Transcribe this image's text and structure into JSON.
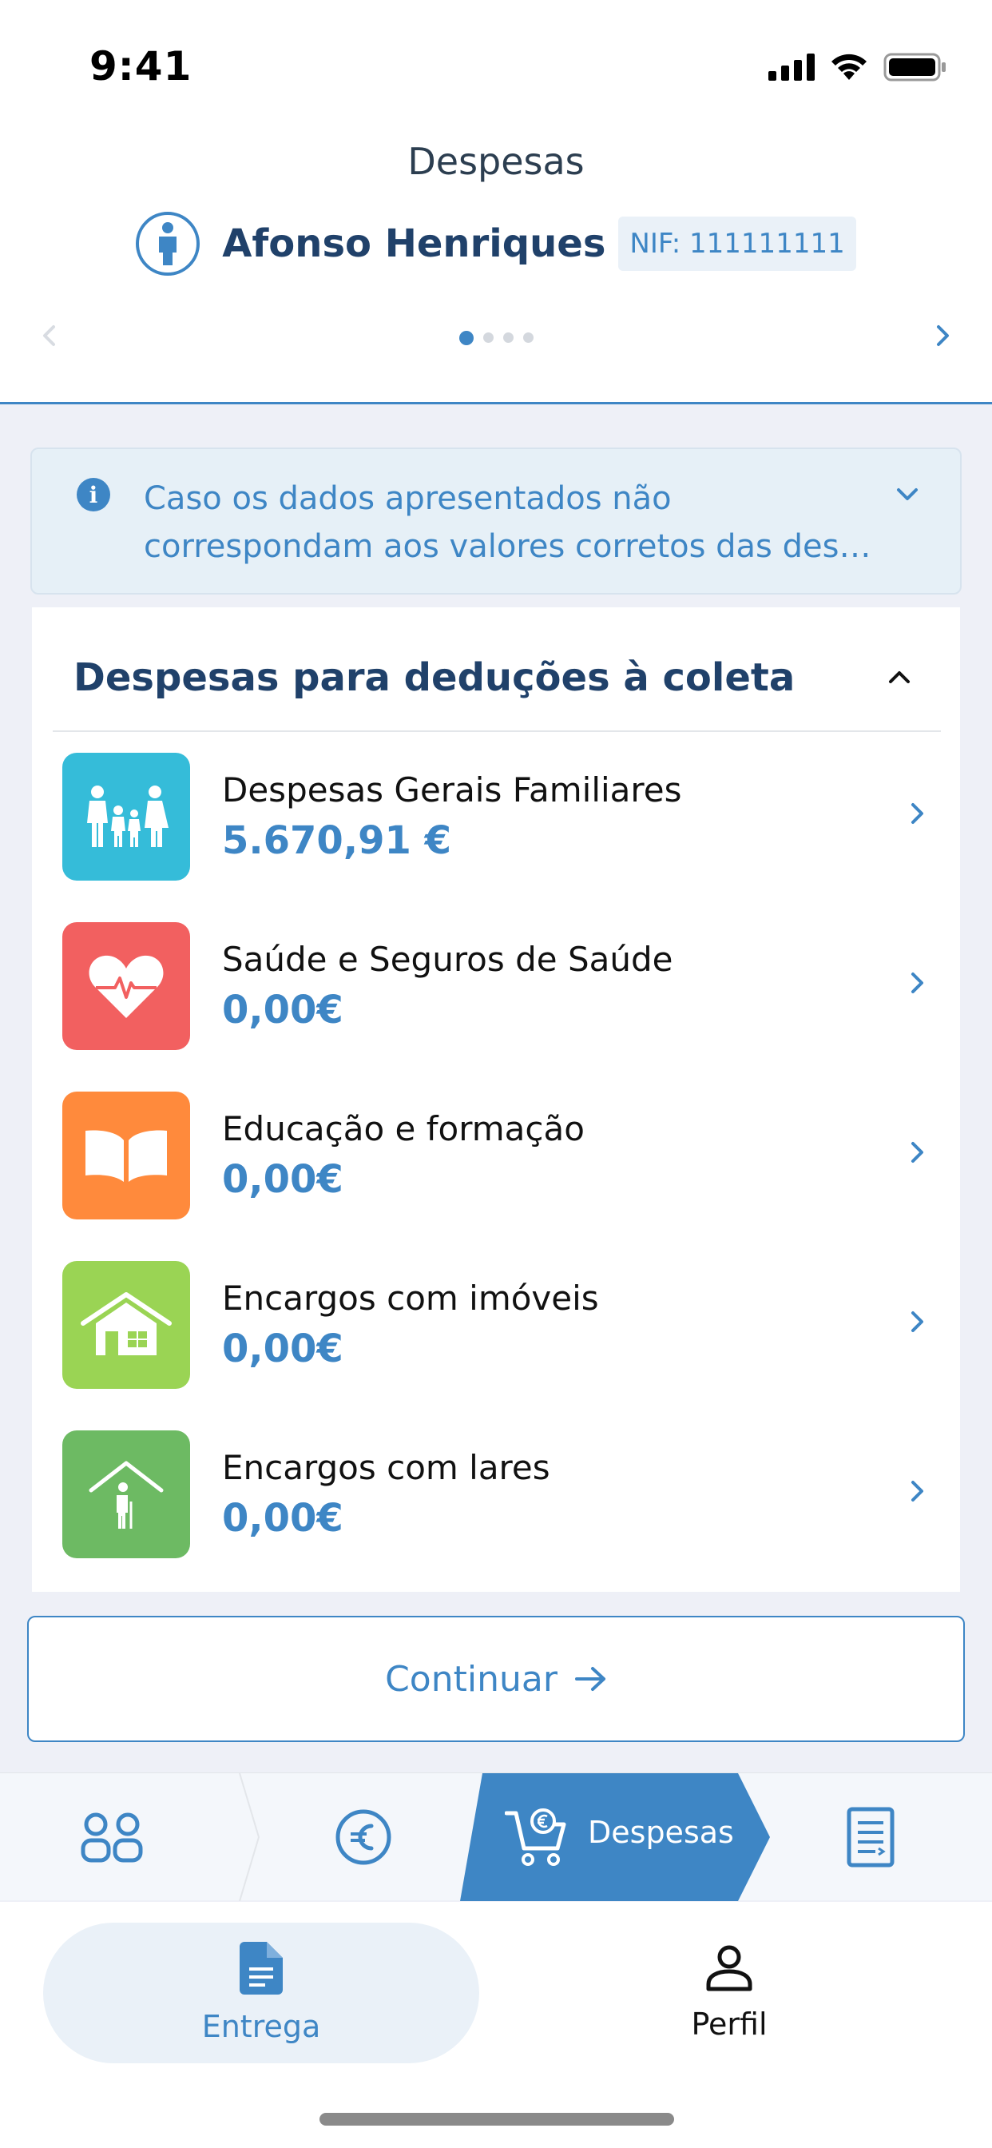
{
  "status_bar": {
    "time": "9:41"
  },
  "header": {
    "title": "Despesas",
    "user_name": "Afonso Henriques",
    "nif": "NIF: 111111111",
    "pager": {
      "pages": 4,
      "current": 1
    }
  },
  "info": {
    "text": "Caso os dados apresentados não correspondam aos valores corretos das des…"
  },
  "section": {
    "title": "Despesas para deduções à coleta",
    "items": [
      {
        "label": "Despesas Gerais Familiares",
        "value": "5.670,91 €",
        "icon": "family-icon",
        "color": "#35bcd9"
      },
      {
        "label": "Saúde e Seguros de Saúde",
        "value": "0,00€",
        "icon": "heart-icon",
        "color": "#f26060"
      },
      {
        "label": "Educação e formação",
        "value": "0,00€",
        "icon": "book-icon",
        "color": "#ff8a3c"
      },
      {
        "label": "Encargos com imóveis",
        "value": "0,00€",
        "icon": "house-icon",
        "color": "#9ad454"
      },
      {
        "label": "Encargos com lares",
        "value": "0,00€",
        "icon": "elderly-home-icon",
        "color": "#6dba63"
      }
    ]
  },
  "continue_button": {
    "label": "Continuar"
  },
  "steps": {
    "items": [
      "household-icon",
      "euro-icon",
      "cart-icon",
      "document-icon"
    ],
    "active_label": "Despesas"
  },
  "tabbar": {
    "entrega_label": "Entrega",
    "perfil_label": "Perfil"
  },
  "colors": {
    "accent": "#3e86c5",
    "navy": "#20416a"
  }
}
